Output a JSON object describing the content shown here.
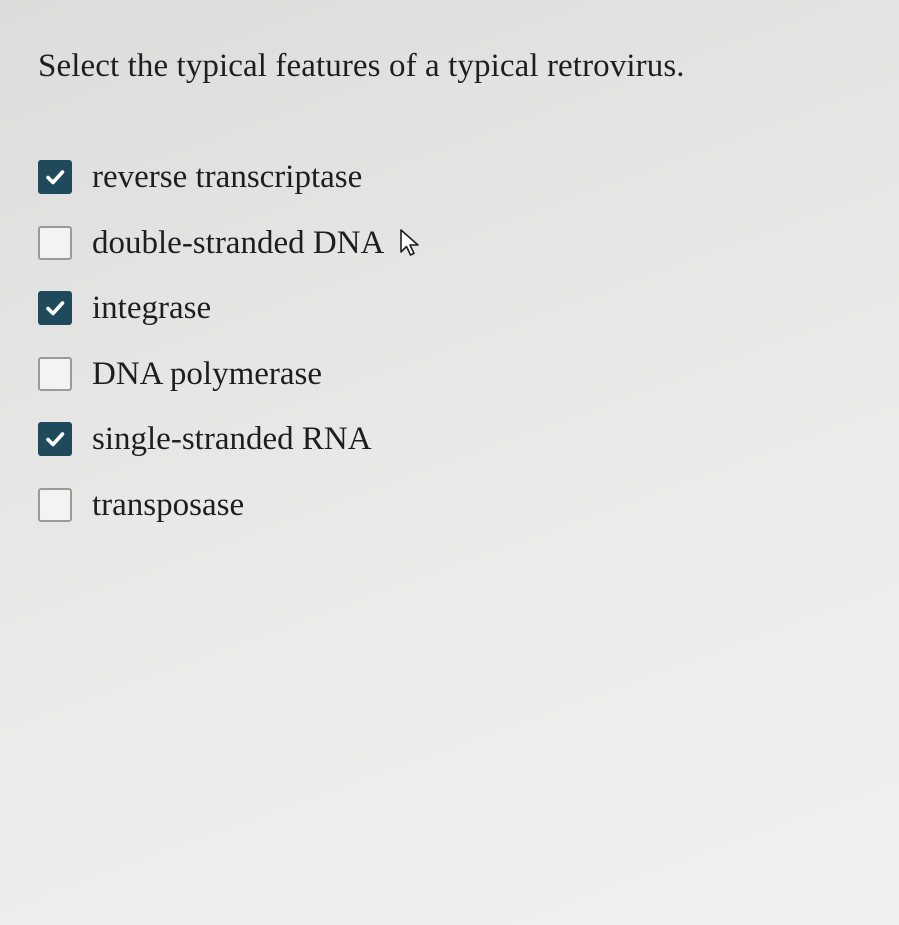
{
  "question": {
    "text": "Select the typical features of a typical retrovirus."
  },
  "options": [
    {
      "label": "reverse transcriptase",
      "checked": true
    },
    {
      "label": "double-stranded DNA",
      "checked": false
    },
    {
      "label": "integrase",
      "checked": true
    },
    {
      "label": "DNA polymerase",
      "checked": false
    },
    {
      "label": "single-stranded RNA",
      "checked": true
    },
    {
      "label": "transposase",
      "checked": false
    }
  ],
  "colors": {
    "checked_fill": "#1f4a5c",
    "unchecked_border": "#9a9a9a",
    "text": "#1e1e1e"
  },
  "cursor": {
    "icon": "arrow-pointer-icon"
  }
}
